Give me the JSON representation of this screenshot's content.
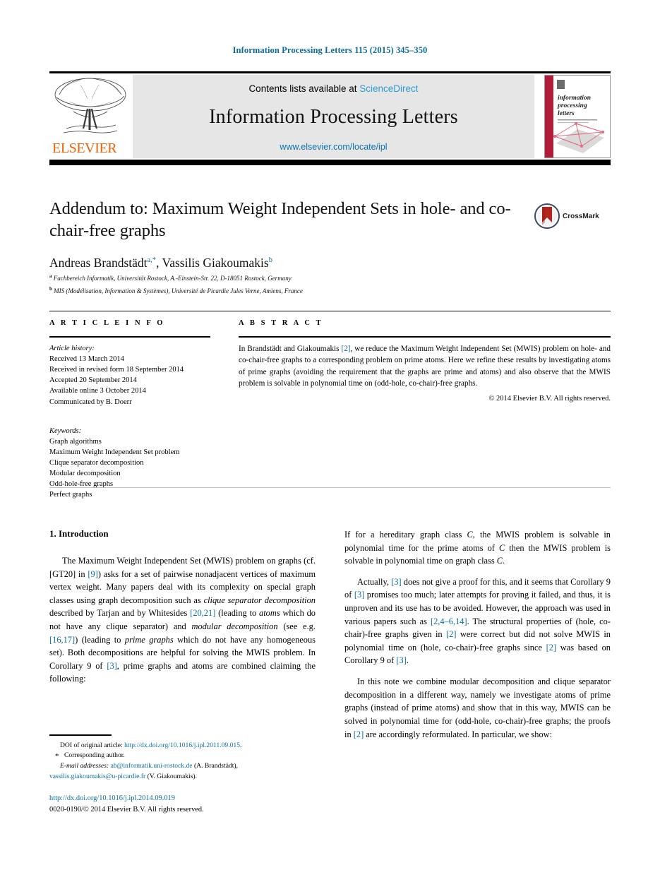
{
  "running_head": "Information Processing Letters 115 (2015) 345–350",
  "masthead": {
    "publisher": "ELSEVIER",
    "contents_prefix": "Contents lists available at ",
    "contents_link": "ScienceDirect",
    "journal_title": "Information Processing Letters",
    "journal_url": "www.elsevier.com/locate/ipl",
    "cover_lines": [
      "information",
      "processing",
      "letters"
    ]
  },
  "title_block": {
    "title": "Addendum to: Maximum Weight Independent Sets in hole- and co-chair-free graphs",
    "authors_plain": "Andreas Brandstädt a,*, Vassilis Giakoumakis b",
    "author1": "Andreas Brandstädt",
    "author1_marks": "a,*",
    "author2": "Vassilis Giakoumakis",
    "author2_marks": "b",
    "affiliation_a_mark": "a",
    "affiliation_a": "Fachbereich Informatik, Universität Rostock, A.-Einstein-Str. 22, D-18051 Rostock, Germany",
    "affiliation_b_mark": "b",
    "affiliation_b": "MIS (Modélisation, Information & Systèmes), Université de Picardie Jules Verne, Amiens, France",
    "crossmark_label": "CrossMark"
  },
  "article_info": {
    "heading": "A R T I C L E    I N F O",
    "history_label": "Article history:",
    "history": [
      "Received 13 March 2014",
      "Received in revised form 18 September 2014",
      "Accepted 20 September 2014",
      "Available online 3 October 2014",
      "Communicated by B. Doerr"
    ],
    "keywords_label": "Keywords:",
    "keywords": [
      "Graph algorithms",
      "Maximum Weight Independent Set problem",
      "Clique separator decomposition",
      "Modular decomposition",
      "Odd-hole-free graphs",
      "Perfect graphs"
    ]
  },
  "abstract": {
    "heading": "A B S T R A C T",
    "part1": "In Brandstädt and Giakoumakis ",
    "ref1": "[2]",
    "part2": ", we reduce the Maximum Weight Independent Set (MWIS) problem on hole- and co-chair-free graphs to a corresponding problem on prime atoms. Here we refine these results by investigating atoms of prime graphs (avoiding the requirement that the graphs are prime and atoms) and also observe that the MWIS problem is solvable in polynomial time on (odd-hole, co-chair)-free graphs.",
    "copyright": "© 2014 Elsevier B.V. All rights reserved."
  },
  "body": {
    "section1_title": "1. Introduction",
    "left_para1": {
      "t1": "The Maximum Weight Independent Set (MWIS) problem on graphs (cf. [GT20] in ",
      "r1": "[9]",
      "t2": ") asks for a set of pairwise nonadjacent vertices of maximum vertex weight. Many papers deal with its complexity on special graph classes using graph decomposition such as ",
      "i1": "clique separator decomposition",
      "t3": " described by Tarjan and by Whitesides ",
      "r2": "[20,21]",
      "t4": " (leading to ",
      "i2": "atoms",
      "t5": " which do not have any clique separator) and ",
      "i3": "modular decomposition",
      "t6": " (see e.g. ",
      "r3": "[16,17]",
      "t7": ") (leading to ",
      "i4": "prime graphs",
      "t8": " which do not have any homogeneous set). Both decompositions are helpful for solving the MWIS problem. In Corollary 9 of ",
      "r4": "[3]",
      "t9": ", prime graphs and atoms are combined claiming the following:"
    },
    "right_para1": {
      "t1": "If for a hereditary graph class ",
      "c1": "C",
      "t2": ", the MWIS problem is solvable in polynomial time for the prime atoms of ",
      "c2": "C",
      "t3": " then the MWIS problem is solvable in polynomial time on graph class ",
      "c3": "C",
      "t4": "."
    },
    "right_para2": {
      "t1": "Actually, ",
      "r1": "[3]",
      "t2": " does not give a proof for this, and it seems that Corollary 9 of ",
      "r2": "[3]",
      "t3": " promises too much; later attempts for proving it failed, and thus, it is unproven and its use has to be avoided. However, the approach was used in various papers such as ",
      "r3": "[2,4–6,14]",
      "t4": ". The structural properties of (hole, co-chair)-free graphs given in ",
      "r4": "[2]",
      "t5": " were correct but did not solve MWIS in polynomial time on (hole, co-chair)-free graphs since ",
      "r5": "[2]",
      "t6": " was based on Corollary 9 of ",
      "r6": "[3]",
      "t7": "."
    },
    "right_para3": {
      "t1": "In this note we combine modular decomposition and clique separator decomposition in a different way, namely we investigate atoms of prime graphs (instead of prime atoms) and show that in this way, MWIS can be solved in polynomial time for (odd-hole, co-chair)-free graphs; the proofs in ",
      "r1": "[2]",
      "t2": " are accordingly reformulated. In particular, we show:"
    }
  },
  "footnotes": {
    "doi_orig_label": "DOI of original article: ",
    "doi_orig_link": "http://dx.doi.org/10.1016/j.ipl.2011.09.015",
    "doi_orig_tail": ".",
    "corresponding": "Corresponding author.",
    "email_label": "E-mail addresses:",
    "email1": "ab@informatik.uni-rostock.de",
    "email1_owner": " (A. Brandstädt),",
    "email2": "vassilis.giakoumakis@u-picardie.fr",
    "email2_owner": " (V. Giakoumakis).",
    "doi_link": "http://dx.doi.org/10.1016/j.ipl.2014.09.019",
    "issn_line": "0020-0190/© 2014 Elsevier B.V. All rights reserved."
  },
  "colors": {
    "link": "#0c6ca0",
    "science_direct": "#2b9ed4",
    "elsevier_orange": "#eb6209",
    "banner_bg": "#e6e6e6",
    "cover_red": "#b01c3a"
  }
}
